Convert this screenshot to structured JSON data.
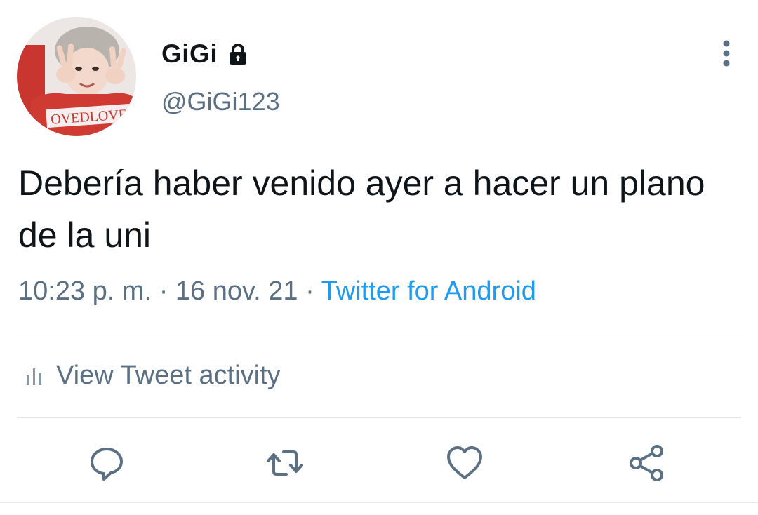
{
  "author": {
    "display_name": "GiGi",
    "handle": "@GiGi123",
    "avatar_shirt_text": "OVEDLOVE",
    "protected_icon": "lock-icon"
  },
  "tweet": {
    "text": "Debería haber venido ayer a hacer un plano de la uni",
    "time": "10:23 p. m.",
    "separator": "·",
    "date": "16 nov. 21",
    "source": "Twitter for Android"
  },
  "activity": {
    "label": "View Tweet activity",
    "icon": "analytics-icon"
  },
  "actions": [
    {
      "name": "reply",
      "icon": "reply-icon"
    },
    {
      "name": "retweet",
      "icon": "retweet-icon"
    },
    {
      "name": "like",
      "icon": "heart-icon"
    },
    {
      "name": "share",
      "icon": "share-icon"
    }
  ],
  "colors": {
    "text": "#0f1419",
    "secondary": "#5b7083",
    "link": "#1d9bf0",
    "divider": "#dfe3e6"
  }
}
